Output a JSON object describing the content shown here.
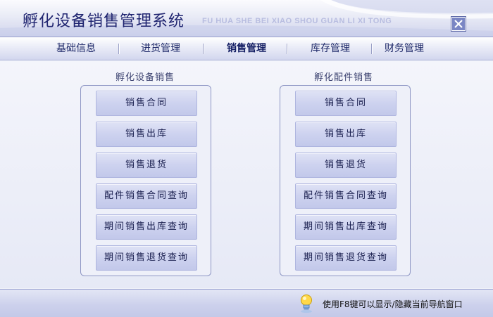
{
  "window": {
    "title": "孵化设备销售管理系统",
    "subtitle": "FU HUA SHE BEI XIAO SHOU GUAN LI XI TONG",
    "close_icon": "close-icon"
  },
  "menu": [
    {
      "label": "基础信息",
      "active": false
    },
    {
      "label": "进货管理",
      "active": false
    },
    {
      "label": "销售管理",
      "active": true
    },
    {
      "label": "库存管理",
      "active": false
    },
    {
      "label": "财务管理",
      "active": false
    }
  ],
  "groups": [
    {
      "title": "孵化设备销售",
      "buttons": [
        "销售合同",
        "销售出库",
        "销售退货",
        "配件销售合同查询",
        "期间销售出库查询",
        "期间销售退货查询"
      ]
    },
    {
      "title": "孵化配件销售",
      "buttons": [
        "销售合同",
        "销售出库",
        "销售退货",
        "配件销售合同查询",
        "期间销售出库查询",
        "期间销售退货查询"
      ]
    }
  ],
  "status": {
    "hint": "使用F8键可以显示/隐藏当前导航窗口",
    "icon": "lightbulb-icon"
  },
  "colors": {
    "title_text": "#1f2470",
    "menu_text": "#1f2a6a",
    "button_fill": "#cdd2ef",
    "border": "#8e96c4"
  }
}
